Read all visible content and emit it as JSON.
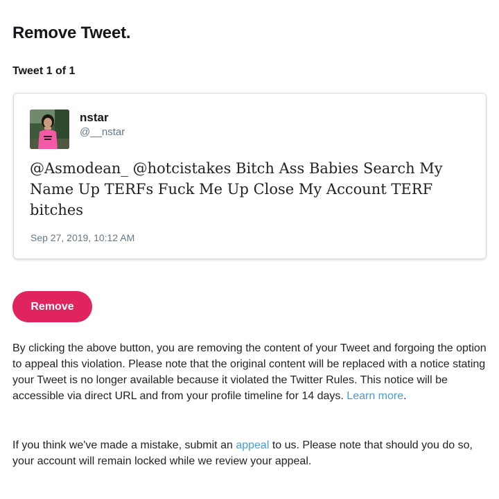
{
  "page": {
    "title": "Remove Tweet.",
    "counter": "Tweet 1 of 1"
  },
  "tweet": {
    "display_name": "nstar",
    "handle": "@__nstar",
    "text": "@Asmodean_ @hotcistakes Bitch Ass Babies Search My Name Up TERFs Fuck Me Up Close My Account TERF bitches",
    "timestamp": "Sep 27, 2019, 10:12 AM"
  },
  "actions": {
    "remove_label": "Remove"
  },
  "notice": {
    "text": "By clicking the above button, you are removing the content of your Tweet and forgoing the option to appeal this violation. Please note that the original content will be replaced with a notice stating your Tweet is no longer available because it violated the Twitter Rules. This notice will be accessible via direct URL and from your profile timeline for 14 days.",
    "learn_more_label": "Learn more",
    "learn_more_suffix": "."
  },
  "appeal": {
    "prefix": "If you think we've made a mistake, submit an",
    "link_label": "appeal",
    "suffix": "to us. Please note that should you do so, your account will remain locked while we review your appeal."
  },
  "colors": {
    "remove_button": "#e0245e",
    "link": "#4a9bd4",
    "secondary_text": "#657786"
  },
  "icons": {
    "avatar": "user-avatar-photo"
  }
}
